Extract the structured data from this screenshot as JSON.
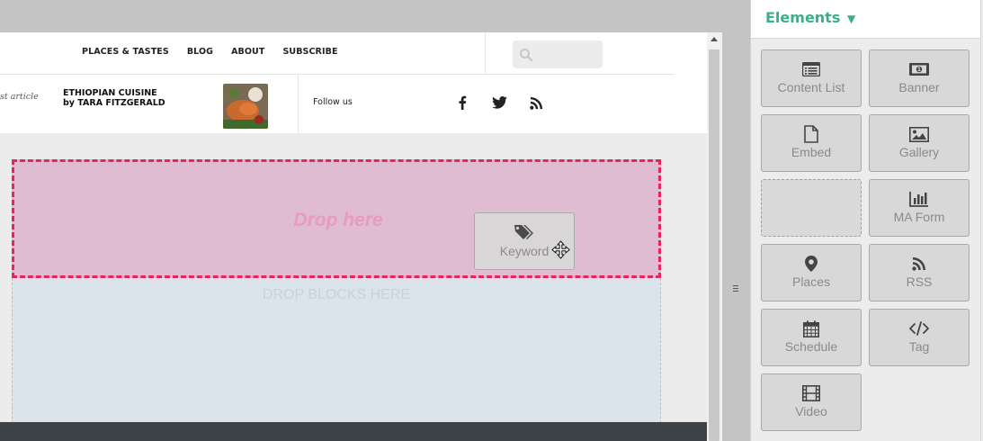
{
  "nav": {
    "items": [
      "PLACES & TASTES",
      "BLOG",
      "ABOUT",
      "SUBSCRIBE"
    ]
  },
  "featured": {
    "label": "st article",
    "title_line1": "ETHIOPIAN CUISINE",
    "title_line2": "by TARA FITZGERALD"
  },
  "social": {
    "follow_label": "Follow us",
    "icons": [
      "facebook-icon",
      "twitter-icon",
      "rss-icon"
    ]
  },
  "canvas": {
    "drop_here": "Drop here",
    "drop_blocks": "DROP BLOCKS HERE"
  },
  "dragging": {
    "label": "Keyword",
    "icon": "tags-icon"
  },
  "panel": {
    "title": "Elements",
    "title_arrow": "▼",
    "tiles": [
      {
        "label": "Content List",
        "icon": "list-icon"
      },
      {
        "label": "Banner",
        "icon": "banner-icon"
      },
      {
        "label": "Embed",
        "icon": "file-icon"
      },
      {
        "label": "Gallery",
        "icon": "image-icon"
      },
      {
        "label": "",
        "icon": ""
      },
      {
        "label": "MA Form",
        "icon": "bar-chart-icon"
      },
      {
        "label": "Places",
        "icon": "map-marker-icon"
      },
      {
        "label": "RSS",
        "icon": "rss-icon"
      },
      {
        "label": "Schedule",
        "icon": "calendar-icon"
      },
      {
        "label": "Tag",
        "icon": "code-icon"
      },
      {
        "label": "Video",
        "icon": "film-icon"
      }
    ]
  },
  "colors": {
    "accent": "#38b08c",
    "drop_border": "#e6255f",
    "drop_fill": "#dfbcd2",
    "drop_text": "#e79bbf",
    "blocks_fill": "#dbe4ea",
    "footer": "#3d4246"
  }
}
